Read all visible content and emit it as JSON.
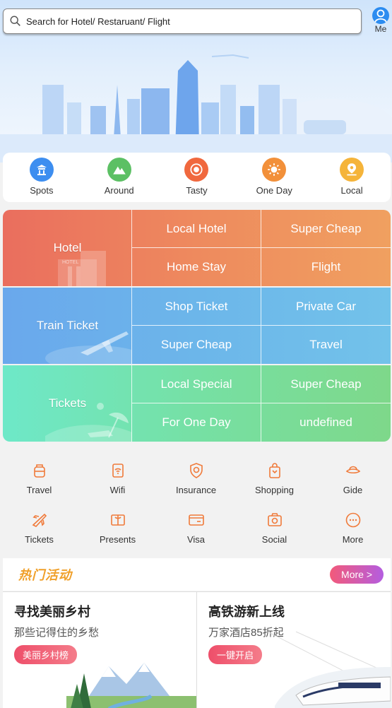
{
  "search": {
    "placeholder": "Search for Hotel/ Restaruant/ Flight",
    "icon": "search-icon"
  },
  "profile": {
    "label": "Me",
    "icon": "user-icon"
  },
  "quick": [
    {
      "label": "Spots",
      "icon": "temple-icon",
      "color": "#3d8ef0"
    },
    {
      "label": "Around",
      "icon": "mountain-icon",
      "color": "#5cc064"
    },
    {
      "label": "Tasty",
      "icon": "food-icon",
      "color": "#f0683e"
    },
    {
      "label": "One Day",
      "icon": "sun-icon",
      "color": "#f2903a"
    },
    {
      "label": "Local",
      "icon": "location-icon",
      "color": "#f5b43a"
    }
  ],
  "panels": [
    {
      "title": "Hotel",
      "cells": [
        "Local Hotel",
        "Super Cheap",
        "Home Stay",
        "Flight"
      ]
    },
    {
      "title": "Train Ticket",
      "cells": [
        "Shop Ticket",
        "Private Car",
        "Super Cheap",
        "Travel"
      ]
    },
    {
      "title": "Tickets",
      "cells": [
        "Local Special",
        "Super Cheap",
        "For One Day",
        "undefined"
      ]
    }
  ],
  "hotel_sign": "HOTEL",
  "services": [
    {
      "label": "Travel",
      "icon": "backpack-icon"
    },
    {
      "label": "Wifi",
      "icon": "wifi-icon"
    },
    {
      "label": "Insurance",
      "icon": "shield-icon"
    },
    {
      "label": "Shopping",
      "icon": "shopping-bag-icon"
    },
    {
      "label": "Gide",
      "icon": "guide-hat-icon"
    },
    {
      "label": "Tickets",
      "icon": "plane-icon"
    },
    {
      "label": "Presents",
      "icon": "gift-icon"
    },
    {
      "label": "Visa",
      "icon": "card-icon"
    },
    {
      "label": "Social",
      "icon": "camera-icon"
    },
    {
      "label": "More",
      "icon": "more-icon"
    }
  ],
  "activities": {
    "title": "热门活动",
    "more": "More >",
    "cards": [
      {
        "title": "寻找美丽乡村",
        "subtitle": "那些记得住的乡愁",
        "button": "美丽乡村榜"
      },
      {
        "title": "高铁游新上线",
        "subtitle": "万家酒店85折起",
        "button": "一键开启"
      }
    ]
  },
  "colors": {
    "accent": "#f0a02a",
    "service_icon": "#f07a3a"
  }
}
